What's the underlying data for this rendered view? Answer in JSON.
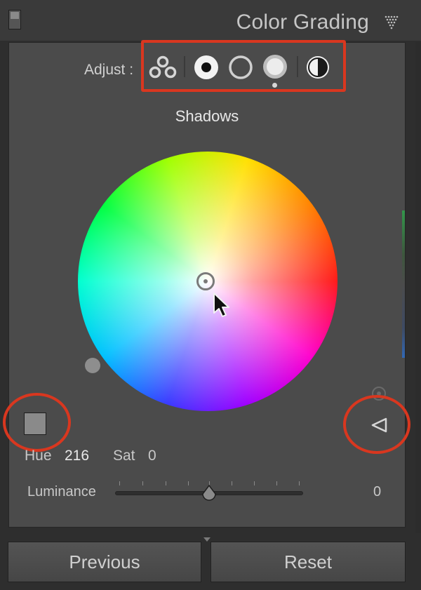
{
  "header": {
    "title": "Color Grading"
  },
  "adjust": {
    "label": "Adjust :",
    "tools": [
      {
        "name": "three-way",
        "icon": "three-circles-icon"
      },
      {
        "name": "shadows",
        "icon": "filled-circle-icon"
      },
      {
        "name": "midtones",
        "icon": "hollow-circle-icon"
      },
      {
        "name": "highlights",
        "icon": "light-circle-icon"
      },
      {
        "name": "global",
        "icon": "half-circle-icon"
      }
    ]
  },
  "wheel": {
    "title": "Shadows",
    "hue_label": "Hue",
    "hue_value": "216",
    "sat_label": "Sat",
    "sat_value": "0",
    "swatch_color": "#8a8a8a"
  },
  "luminance": {
    "label": "Luminance",
    "value": "0",
    "slider_fraction": 0.5
  },
  "footer": {
    "previous_label": "Previous",
    "reset_label": "Reset"
  },
  "colors": {
    "annotation_red": "#d9371f",
    "panel_bg": "#4b4b4b"
  }
}
